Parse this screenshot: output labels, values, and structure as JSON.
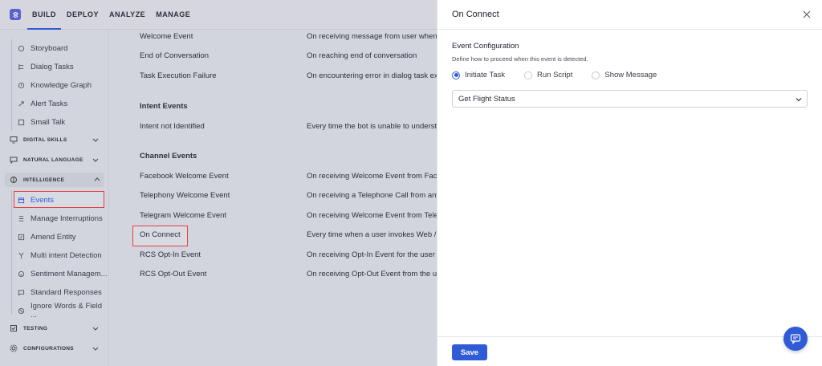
{
  "nav": {
    "items": [
      "BUILD",
      "DEPLOY",
      "ANALYZE",
      "MANAGE"
    ],
    "active": "BUILD"
  },
  "sidebar": {
    "top_items": [
      "Storyboard",
      "Dialog Tasks",
      "Knowledge Graph",
      "Alert Tasks",
      "Small Talk"
    ],
    "sections": {
      "digital_skills": "DIGITAL SKILLS",
      "natural_language": "NATURAL LANGUAGE",
      "intelligence": "INTELLIGENCE",
      "testing": "TESTING",
      "configurations": "CONFIGURATIONS"
    },
    "intelligence_items": [
      "Events",
      "Manage Interruptions",
      "Amend Entity",
      "Multi intent Detection",
      "Sentiment Managem...",
      "Standard Responses",
      "Ignore Words & Field ..."
    ],
    "active_item": "Events"
  },
  "events": {
    "dialog_rows": [
      {
        "name": "Welcome Event",
        "desc": "On receiving message from user when ch"
      },
      {
        "name": "End of Conversation",
        "desc": "On reaching end of conversation"
      },
      {
        "name": "Task Execution Failure",
        "desc": "On encountering error in dialog task exec"
      }
    ],
    "intent_title": "Intent Events",
    "intent_rows": [
      {
        "name": "Intent not Identified",
        "desc": "Every time the bot is unable to understan"
      }
    ],
    "channel_title": "Channel Events",
    "channel_rows": [
      {
        "name": "Facebook Welcome Event",
        "desc": "On receiving Welcome Event from Facebo"
      },
      {
        "name": "Telephony Welcome Event",
        "desc": "On receiving a Telephone Call from any v"
      },
      {
        "name": "Telegram Welcome Event",
        "desc": "On receiving Welcome Event from Telegra"
      },
      {
        "name": "On Connect",
        "desc": "Every time when a user invokes Web / Mo"
      },
      {
        "name": "RCS Opt-In Event",
        "desc": "On receiving Opt-In Event for the user"
      },
      {
        "name": "RCS Opt-Out Event",
        "desc": "On receiving Opt-Out Event from the use"
      }
    ]
  },
  "panel": {
    "title": "On Connect",
    "section_title": "Event Configuration",
    "section_subtitle": "Define how to proceed when this event is detected.",
    "radios": [
      {
        "label": "Initiate Task",
        "checked": true
      },
      {
        "label": "Run Script",
        "checked": false
      },
      {
        "label": "Show Message",
        "checked": false
      }
    ],
    "select_value": "Get Flight Status",
    "save_label": "Save"
  },
  "colors": {
    "accent": "#2f5bd6",
    "highlight": "#e3403f",
    "overlay": "#d3d5de"
  }
}
